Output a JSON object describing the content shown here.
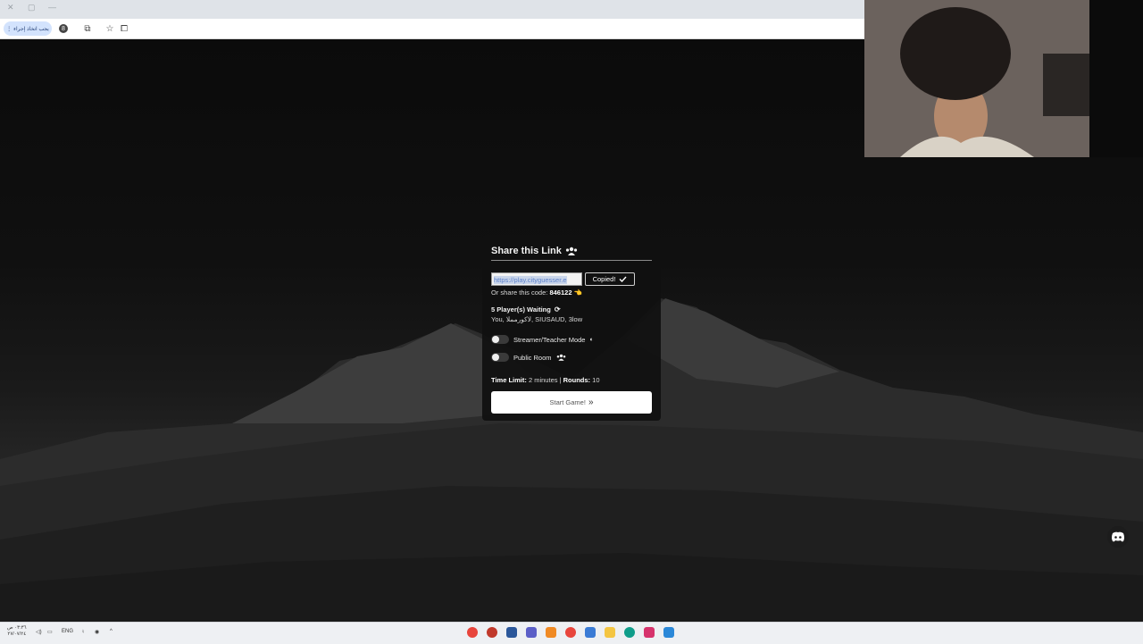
{
  "browser": {
    "window_controls": [
      "✕",
      "▢",
      "—"
    ],
    "extension_label": "يجب اتخاذ إجراء",
    "profile_initial": "8"
  },
  "modal": {
    "title": "Share this Link",
    "link_value": "https://play.cityguesser.e",
    "copied_label": "Copied!",
    "share_code_prefix": "Or share this code:",
    "share_code": "846122",
    "share_code_emoji": "👈",
    "players_waiting": "5 Player(s) Waiting",
    "players_list": "You, لاكورمملا, SIUSAUD, 3low",
    "streamer_mode_label": "Streamer/Teacher Mode",
    "public_room_label": "Public Room",
    "time_limit_label": "Time Limit:",
    "time_limit_value": "2 minutes",
    "separator": "|",
    "rounds_label": "Rounds:",
    "rounds_value": "10",
    "start_button_label": "Start Game!",
    "start_button_icon": "»"
  },
  "taskbar": {
    "time": "٠٣:٣٦ ص",
    "date": "٢٧/٠٧/٢٤",
    "language": "ENG"
  },
  "colors": {
    "accent_link": "#5e82c9",
    "modal_bg": "#101010",
    "start_button_bg": "#ffffff"
  }
}
